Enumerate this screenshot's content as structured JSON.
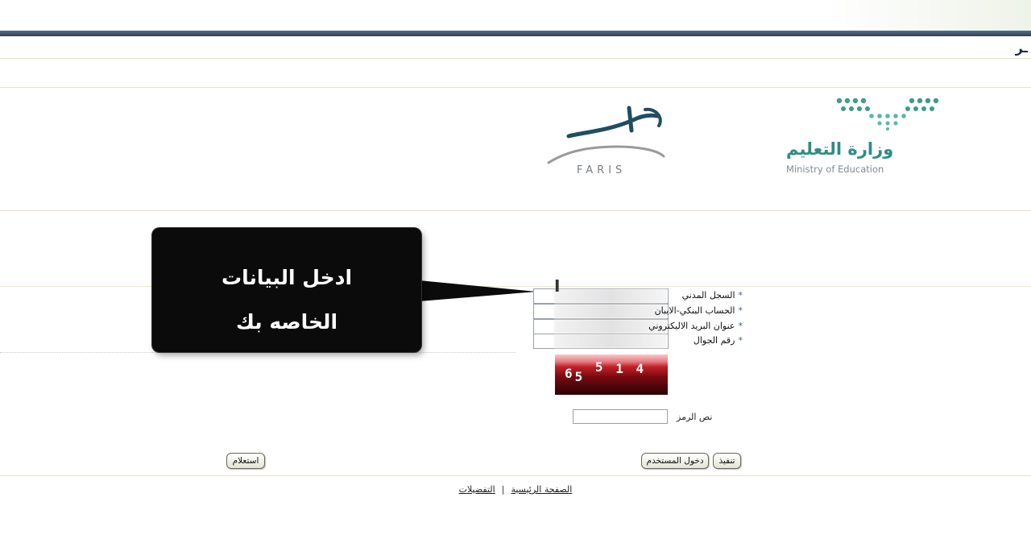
{
  "page": {
    "heading": "ـر"
  },
  "logos": {
    "ministry_ar": "وزارة التعليم",
    "ministry_en": "Ministry of Education",
    "faris_en": "FARIS",
    "faris_ar": "فارس"
  },
  "callout": {
    "line1": "ادخل البيانات",
    "line2": "الخاصه بك"
  },
  "form": {
    "fields": [
      {
        "label": "السجل المدني",
        "required_mark": "*",
        "value": ""
      },
      {
        "label": "الحساب البنكي-الايبان",
        "required_mark": "*",
        "value": ""
      },
      {
        "label": "عنوان البريد الاليكتروني",
        "required_mark": "*",
        "value": ""
      },
      {
        "label": "رقم الجوال",
        "required_mark": "*",
        "value": ""
      }
    ],
    "captcha_text": "65 5 1 4",
    "captcha_parts": [
      "6",
      "5",
      "5",
      "1",
      "4"
    ],
    "code_label": "نص الرمز",
    "code_value": ""
  },
  "buttons": {
    "execute": "تنفيذ",
    "user_login": "دخول المستخدم",
    "inquiry": "استعلام"
  },
  "footer": {
    "home": "الصفحة الرئيسية",
    "separator": "|",
    "preferences": "التفضيلات"
  },
  "colors": {
    "band": "#2c3f57",
    "ministry": "#2f8c86",
    "faris": "#1f4d63",
    "captcha": "#c3222a"
  }
}
